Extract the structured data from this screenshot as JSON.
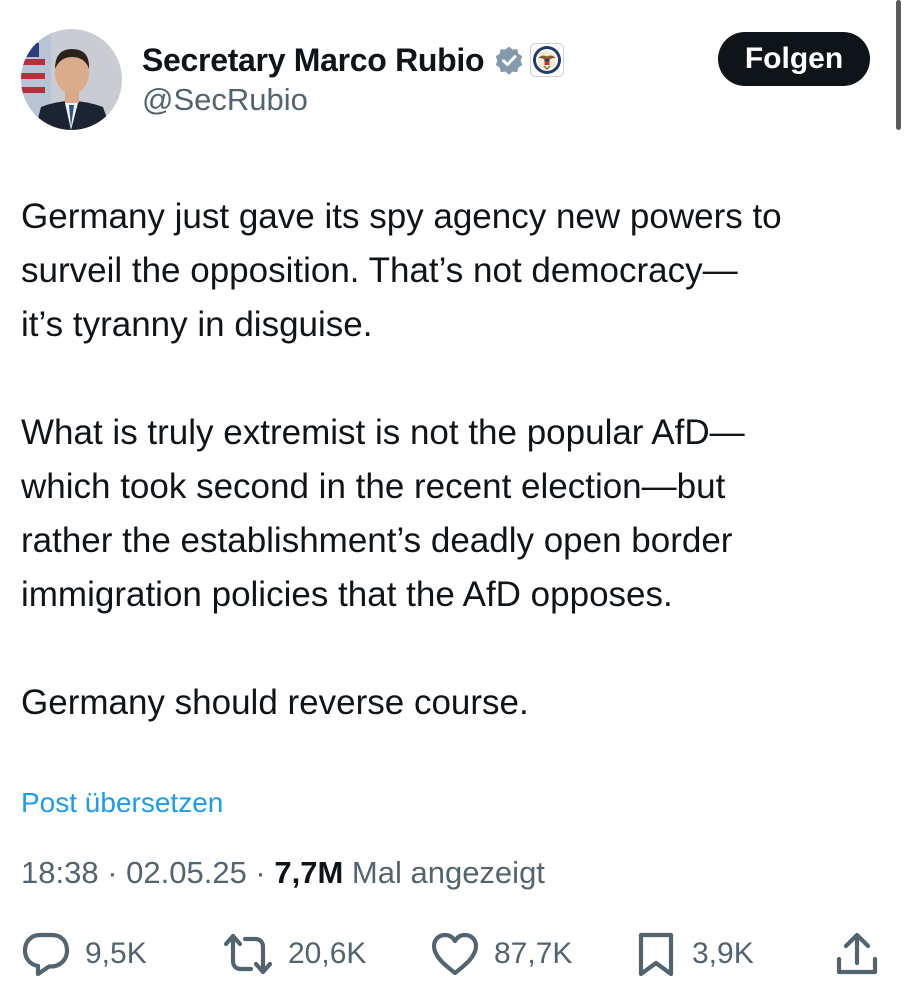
{
  "author": {
    "display_name": "Secretary Marco Rubio",
    "handle": "@SecRubio",
    "verified_badge_icon": "verified-badge-icon",
    "affiliation_icon": "state-department-seal-icon"
  },
  "follow_button": {
    "label": "Folgen"
  },
  "post": {
    "paragraphs": [
      "Germany just gave its spy agency new powers to\nsurveil the opposition.  That’s not democracy—\nit’s tyranny in disguise.",
      "What is truly extremist is not the popular AfD—\nwhich took second in the recent election—but\nrather the establishment’s deadly open border\nimmigration policies that the AfD opposes.",
      "Germany should reverse course."
    ],
    "translate_link": "Post übersetzen",
    "time": "18:38",
    "separator": " · ",
    "date": "02.05.25",
    "views_count": "7,7M",
    "views_label": " Mal angezeigt"
  },
  "actions": {
    "replies": "9,5K",
    "reposts": "20,6K",
    "likes": "87,7K",
    "bookmarks": "3,9K"
  },
  "colors": {
    "text": "#0f1419",
    "secondary": "#536471",
    "link": "#1d9bf0",
    "button_bg": "#0f1419",
    "badge": "#829aab"
  }
}
